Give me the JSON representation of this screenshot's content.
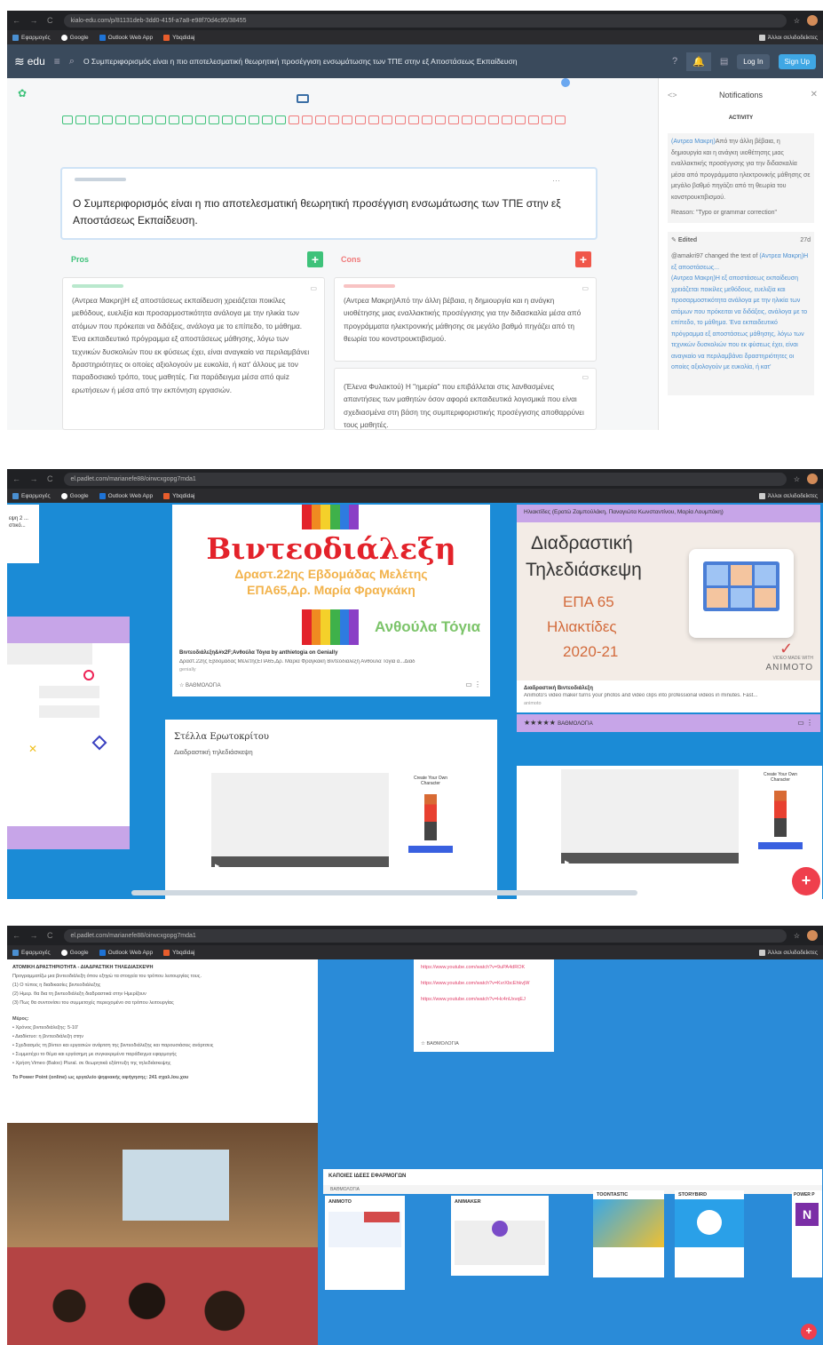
{
  "shot1": {
    "url": "kialo-edu.com/p/81131deb-3dd0-415f-a7a8-e98f70d4c95/38455",
    "bookmarks": [
      "Εφαρμογές",
      "Google",
      "Outlook Web App",
      "Ybqdidaj"
    ],
    "bookmarks_right": "Άλλοι σελιδοδείκτες",
    "logo": "edu",
    "header_title": "Ο Συμπεριφορισμός είναι η πιο αποτελεσματική θεωρητική προσέγγιση ενσωμάτωσης των ΤΠΕ στην εξ Αποστάσεως Εκπαίδευση",
    "login": "Log In",
    "signup": "Sign Up",
    "thesis": "Ο Συμπεριφορισμός είναι η πιο αποτελεσματική θεωρητική προσέγγιση ενσωμάτωσης των ΤΠΕ στην εξ Αποστάσεως Εκπαίδευση.",
    "pros_label": "Pros",
    "cons_label": "Cons",
    "pro_card": "(Αντρεα Μακρη)Η εξ αποστάσεως εκπαίδευση χρειάζεται ποικίλες μεθόδους, ευελιξία και προσαρμοστικότητα ανάλογα με την ηλικία των ατόμων που πρόκειται να διδάξεις, ανάλογα με το επίπεδο, το μάθημα. Ένα εκπαιδευτικό πρόγραμμα εξ αποστάσεως μάθησης, λόγω των τεχνικών δυσκολιών που εκ φύσεως έχει, είναι αναγκαίο να περιλαμβάνει δραστηριότητες οι οποίες αξιολογούν με ευκολία, ή κατ' άλλους με τον παραδοσιακό τρόπο, τους μαθητές. Για παράδειγμα μέσα από quiz ερωτήσεων ή μέσα από την εκπόνηση εργασιών.",
    "con_card1": "(Αντρεα Μακρη)Από την άλλη βέβαια, η δημιουργία και η ανάγκη υιοθέτησης μιας εναλλακτικής προσέγγισης για την διδασκαλία μέσα από προγράμματα ηλεκτρονικής μάθησης σε μεγάλο βαθμό πηγάζει από τη θεωρία του κονστρουκτιβισμού.",
    "con_card2": "(Έλενα Φυλακτού) Η \"ημερία\" που επιβάλλεται στις λανθασμένες απαντήσεις των μαθητών όσον αφορά εκπαιδευτικά λογισμικά που είναι σχεδιασμένα στη βάση της συμπεριφοριστικής προσέγγισης αποθαρρύνει τους μαθητές.",
    "notif_title": "Notifications",
    "notif_tab": "ACTIVITY",
    "notif1_author": "(Αντρεα Μακρη)",
    "notif1": "Από την άλλη βέβαια, η δημιουργία και η ανάγκη υιοθέτησης μιας εναλλακτικής προσέγγισης για την διδασκαλία μέσα από προγράμματα ηλεκτρονικής μάθησης σε μεγάλο βαθμό πηγάζει από τη θεωρία του κονστρουκτιβισμού.",
    "notif1_reason": "Reason: \"Typo or grammar correction\"",
    "edited": "Edited",
    "edited_time": "27d",
    "notif2_user": "@amakri97 changed the text of",
    "notif2_link": "(Αντρεα Μακρη)Η εξ αποστάσεως...",
    "notif2": "(Αντρεα Μακρη)Η εξ αποστάσεως εκπαίδευση χρειάζεται ποικίλες μεθόδους, ευελιξία και προσαρμοστικότητα ανάλογα με την ηλικία των ατόμων που πρόκειται να διδάξεις, ανάλογα με το επίπεδο, το μάθημα. Ένα εκπαιδευτικό πρόγραμμα εξ αποστάσεως μάθησης, λόγω των τεχνικών δυσκολιών που εκ φύσεως έχει, είναι αναγκαίο να περιλαμβάνει δραστηριότητες οι οποίες αξιολογούν με ευκολία, ή κατ'"
  },
  "shot2": {
    "url": "el.padlet.com/marianefe88/oirwcxgopg7mda1",
    "bookmarks": [
      "Εφαρμογές",
      "Google",
      "Outlook Web App",
      "Ybqdidaj"
    ],
    "bookmarks_right": "Άλλοι σελιδοδείκτες",
    "card1_title": "Βιντεοδιάλεξη",
    "card1_sub1": "Δραστ.22ης Εβδομάδας Μελέτης",
    "card1_sub2": "ΕΠΑ65,Δρ. Μαρία Φραγκάκη",
    "card1_author": "Ανθούλα Τόγια",
    "card1_caption": "Βιντεοδιάλεξη&#x2F;Ανθούλα Τόγια by anthietogia on Genially",
    "card1_desc": "Δραστ.22ης Εβδομάδας ΜελέτηςΕΠΑ65,Δρ. Μαρία Φραγκάκη Βιντεοδιάλεξη Ανθούλα Τόγια α...Διαδ",
    "card1_domain": "genially",
    "rating_label": "ΒΑΘΜΟΛΟΓΙΑ",
    "card2_header": "Ηλιακτίδες (Ερατώ Ζαμπούλάκη, Παναγιώτα Κωνσταντίνου, Μαρία Λουμπάκη)",
    "card2_t1": "Διαδραστική",
    "card2_t2": "Τηλεδιάσκεψη",
    "card2_t3": "ΕΠΑ 65",
    "card2_t4": "Ηλιακτίδες",
    "card2_t5": "2020-21",
    "card2_brand_small": "VIDEO MADE WITH",
    "card2_brand": "ANIMOTO",
    "card2_caption": "Διαδραστική Βιντεοδιάλεξη",
    "card2_desc": "Animoto's video maker turns your photos and video clips into professional videos in minutes. Fast...",
    "card2_domain": "animoto",
    "card3_title": "Στέλλα Ερωτοκρίτου",
    "card3_sub": "Διαδραστική τηλεδιάσκεψη",
    "char_label": "Create Your Own Character",
    "left_text": "εψη 2 ...\nστικό..."
  },
  "shot3": {
    "url": "el.padlet.com/marianefe88/oirwcxgopg7mda1",
    "bookmarks": [
      "Εφαρμογές",
      "Google",
      "Outlook Web App",
      "Ybqdidaj"
    ],
    "bookmarks_right": "Άλλοι σελιδοδείκτες",
    "doc_title": "ΑΤΟΜΙΚΗ ΔΡΑΣΤΗΡΙΟΤΗΤΑ - ΔΙΑΔΡΑΣΤΙΚΗ ΤΗΛΕΔΙΑΣΚΕΨΗ",
    "doc_lines": [
      "Προγραμματίζω μια βιντεοδιάλεξη όπου εξηγώ τα στοιχεία του τρόπου λειτουργίας τους.",
      "(1) Ο τύπος η διαδικασίες βιντεοδιάλεξης",
      "(2) Ημερ. θα δια τη βιντεοδιάλεξη διαδραστικά στην Ημερίζουν",
      "(3) Πως θα συντονίσει του συμμετοχές περιεχομένο σα τρόπου λειτουργίας"
    ],
    "doc_h2": "Μέρος:",
    "doc_bullets": [
      "Χρόνος βιντεοδιάλεξης: 5-10'",
      "Διαδίκτυο: η βιντεοδιάλεξη στην",
      "Σχεδιασμός τη βίντεο και εργασιών ανάρτση της βιντεοδιάλεξης και παρουσιάσεις ανάρτσεις",
      "Συμμετέχει το θέμα και εργάσημη με συγκεκριμένα παράδειγμα εφαρμογής",
      "Χρήση Vimeo (Baloo) Plural. σε θεωρητικά εξάπτυξη της τηλεδιάσκεψης"
    ],
    "doc_pp": "Το Power Point (online) ως εργαλείο ψηφιακής αφήγησης: 241 σχαλ.Ιου.χου",
    "links": [
      "https://www.youtube.com/watch?v=9uPA4dROK",
      "https://www.youtube.com/watch?v=KvrXbcEhkvjW",
      "https://www.youtube.com/watch?v=Hc4nUxvqEJ"
    ],
    "section_title": "ΚΑΠΟΙΕΣ ΙΔΕΕΣ ΕΦΑΡΜΟΓΩΝ",
    "rating_label": "ΒΑΘΜΟΛΟΓΙΑ",
    "apps": [
      "ANIMOTO",
      "ANIMAKER",
      "TOONTASTIC",
      "STORYBIRD",
      "POWER P"
    ]
  }
}
